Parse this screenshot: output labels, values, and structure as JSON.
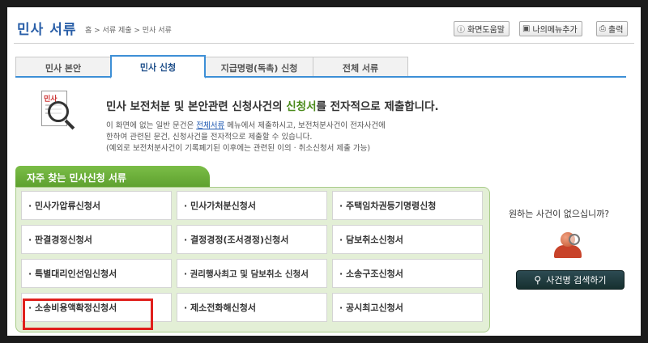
{
  "header": {
    "title": "민사 서류",
    "breadcrumb": "홈 > 서류 제출 > 민사 서류",
    "buttons": [
      {
        "icon": "help-icon",
        "glyph": "ⓘ",
        "label": "화면도움말"
      },
      {
        "icon": "folder-icon",
        "glyph": "▣",
        "label": "나의메뉴추가"
      },
      {
        "icon": "printer-icon",
        "glyph": "⎙",
        "label": "출력"
      }
    ]
  },
  "tabs": [
    {
      "label": "민사 본안",
      "active": false
    },
    {
      "label": "민사 신청",
      "active": true
    },
    {
      "label": "지급명령(독촉) 신청",
      "active": false
    },
    {
      "label": "전체 서류",
      "active": false
    }
  ],
  "intro": {
    "icon_tag": "민사",
    "headline_pre": "민사 보전처분 및 본안관련 신청사건의 ",
    "headline_hl": "신청서",
    "headline_post": "를 전자적으로 제출합니다.",
    "line1_pre": "이 화면에 없는 일반 문건은 ",
    "line1_link": "전체서류",
    "line1_post": " 메뉴에서 제출하시고, 보전처분사건이 전자사건에",
    "line2": "한하여 관련된 문건, 신청사건을 전자적으로 제출할 수 있습니다.",
    "line3": "(예외로 보전처분사건이 기록폐기된 이후에는 관련된 이의 · 취소신청서 제출 가능)"
  },
  "panel": {
    "title": "자주 찾는 민사신청 서류",
    "items": [
      [
        "· 민사가압류신청서",
        "· 민사가처분신청서",
        "· 주택임차권등기명령신청"
      ],
      [
        "· 판결경정신청서",
        "· 결정경정(조서경정)신청서",
        "· 담보취소신청서"
      ],
      [
        "· 특별대리인선임신청서",
        "· 권리행사최고 및 담보취소 신청서",
        "· 소송구조신청서"
      ],
      [
        "· 소송비용액확정신청서",
        "· 제소전화해신청서",
        "· 공시최고신청서"
      ]
    ]
  },
  "side": {
    "question": "원하는 사건이 없으십니까?",
    "search_button": "사건명 검색하기"
  },
  "colors": {
    "accent_blue": "#3d8fd6",
    "panel_green": "#6aaf38",
    "highlight_red": "#e0201c"
  }
}
